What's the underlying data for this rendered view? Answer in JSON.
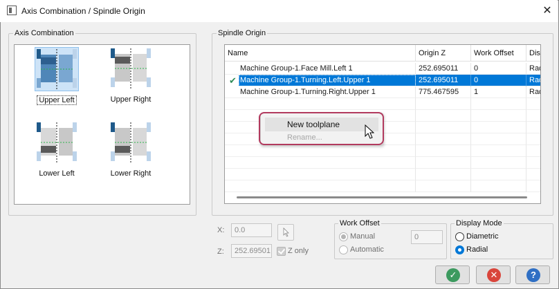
{
  "window": {
    "title": "Axis Combination / Spindle Origin",
    "close_glyph": "✕"
  },
  "axis_combination": {
    "legend": "Axis Combination",
    "items": [
      {
        "label": "Upper Left",
        "selected": true
      },
      {
        "label": "Upper Right",
        "selected": false
      },
      {
        "label": "Lower Left",
        "selected": false
      },
      {
        "label": "Lower Right",
        "selected": false
      }
    ]
  },
  "spindle_origin": {
    "legend": "Spindle Origin",
    "columns": [
      "Name",
      "Origin Z",
      "Work Offset",
      "Disp"
    ],
    "rows": [
      {
        "name": "Machine Group-1.Face Mill.Left 1",
        "origin_z": "252.695011",
        "work_offset": "0",
        "display": "Rad",
        "selected": false,
        "checked": false
      },
      {
        "name": "Machine Group-1.Turning.Left.Upper 1",
        "origin_z": "252.695011",
        "work_offset": "0",
        "display": "Rad",
        "selected": true,
        "checked": true
      },
      {
        "name": "Machine Group-1.Turning.Right.Upper 1",
        "origin_z": "775.467595",
        "work_offset": "1",
        "display": "Rad",
        "selected": false,
        "checked": false
      }
    ]
  },
  "context_menu": {
    "items": [
      {
        "label": "New toolplane",
        "enabled": true
      },
      {
        "label": "Rename...",
        "enabled": false
      }
    ]
  },
  "origin_fields": {
    "x_label": "X:",
    "x_value": "0.0",
    "z_label": "Z:",
    "z_value": "252.69501",
    "z_only_label": "Z only"
  },
  "work_offset": {
    "legend": "Work Offset",
    "manual_label": "Manual",
    "automatic_label": "Automatic",
    "value": "0"
  },
  "display_mode": {
    "legend": "Display Mode",
    "diametric_label": "Diametric",
    "radial_label": "Radial",
    "selected": "Radial"
  },
  "buttons": {
    "ok": {
      "icon": "ok-icon",
      "glyph": "✓",
      "color": "#3c9a5f"
    },
    "cancel": {
      "icon": "cancel-icon",
      "glyph": "✕",
      "color": "#d9453b"
    },
    "help": {
      "icon": "help-icon",
      "glyph": "?",
      "color": "#2f6fc4"
    }
  },
  "colors": {
    "selection": "#0078d7",
    "highlight_ring": "#b23a5e"
  }
}
